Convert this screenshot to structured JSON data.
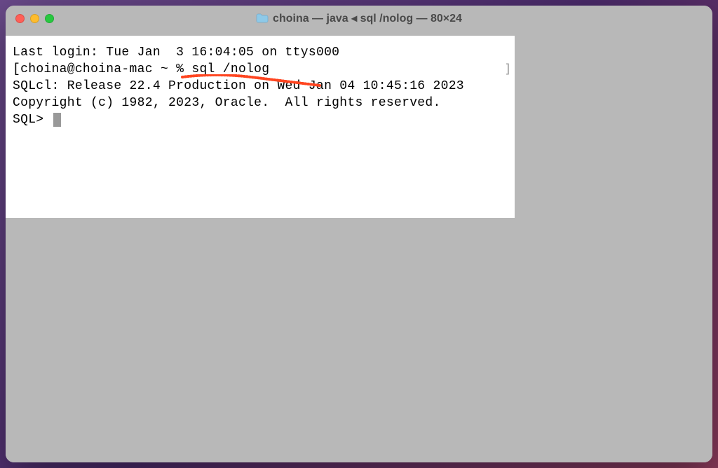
{
  "window": {
    "title": "choina — java ◂ sql /nolog — 80×24"
  },
  "terminal": {
    "line1": "Last login: Tue Jan  3 16:04:05 on ttys000",
    "line2_prefix": "[",
    "line2": "choina@choina-mac ~ % sql /nolog",
    "blank1": "",
    "blank2": "",
    "line3": "SQLcl: Release 22.4 Production on Wed Jan 04 10:45:16 2023",
    "blank3": "",
    "line4": "Copyright (c) 1982, 2023, Oracle.  All rights reserved.",
    "blank4": "",
    "prompt": "SQL> ",
    "right_bracket": "]"
  }
}
